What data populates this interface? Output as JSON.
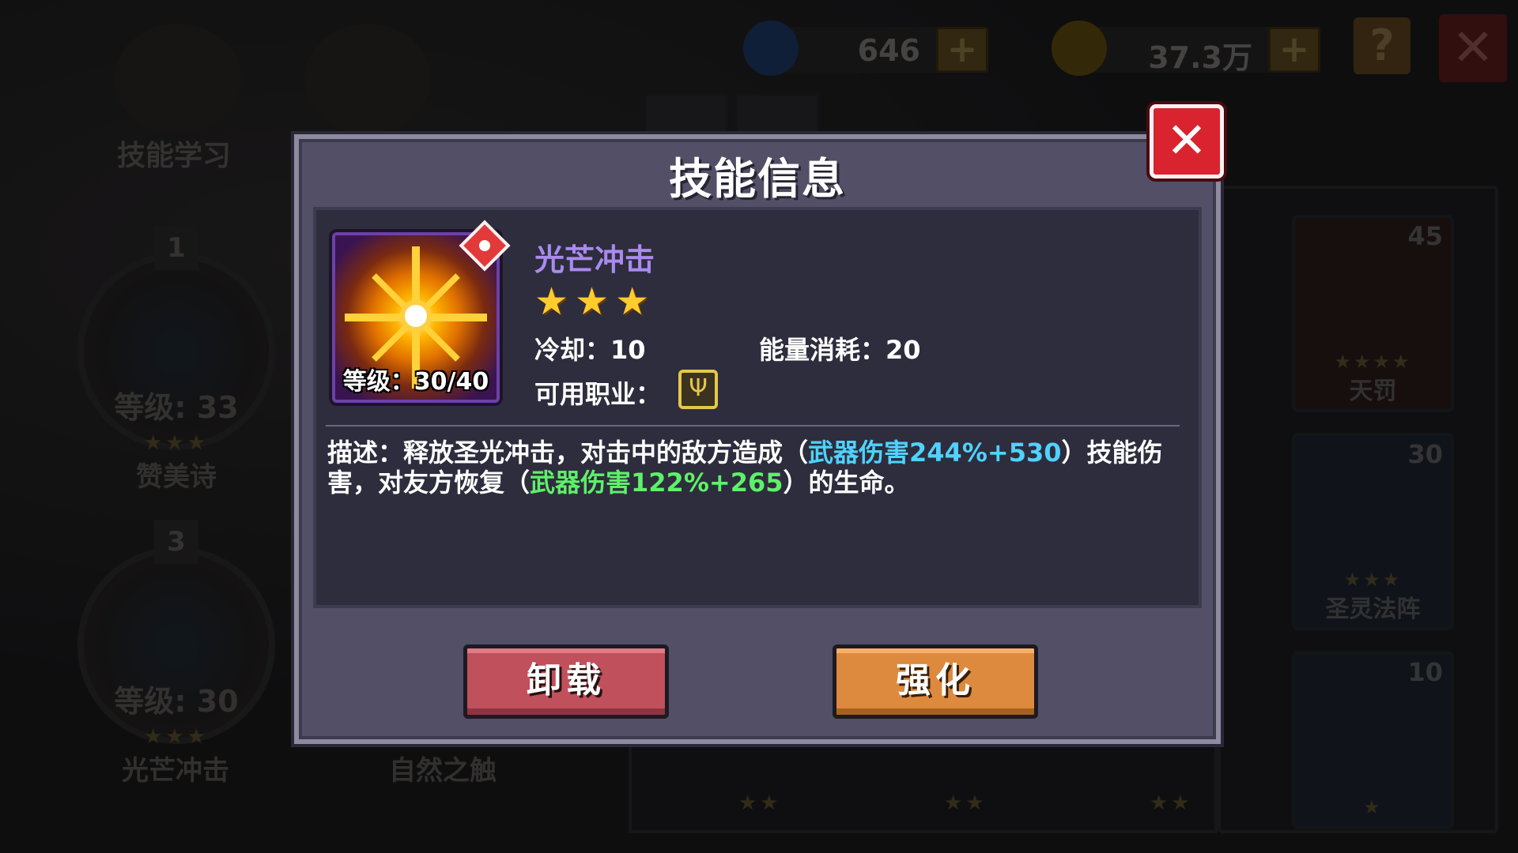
{
  "topbar": {
    "gems": "646",
    "gold": "37.3万",
    "plus": "+",
    "help": "?",
    "close": "✕"
  },
  "left_menu": {
    "skill_learn_label": "技能学习",
    "slot1": {
      "num": "1",
      "level": "等级: 33",
      "stars": "★★★",
      "name": "赞美诗"
    },
    "slot3": {
      "num": "3",
      "level": "等级: 30",
      "stars": "★★★",
      "name": "光芒冲击"
    },
    "nature_touch": "自然之触"
  },
  "right_panel": {
    "cards": [
      {
        "n": "45",
        "stars": "★★★★",
        "name": "天罚"
      },
      {
        "n": "30",
        "stars": "★★★",
        "name": "圣灵法阵"
      },
      {
        "n": "10",
        "stars": "★",
        "name": ""
      }
    ],
    "bottom_stars": [
      "★★",
      "★★",
      "★★"
    ]
  },
  "dialog": {
    "title": "技能信息",
    "skill": {
      "name": "光芒冲击",
      "stars": "★★★",
      "level_text": "等级：30/40",
      "cooldown": "冷却：10",
      "energy": "能量消耗：20",
      "class_label": "可用职业：",
      "class_icon": "priest-class-icon"
    },
    "description": {
      "prefix": "描述：释放圣光冲击，对击中的敌方造成（",
      "damage": "武器伤害244%+530",
      "middle": "）技能伤害，对友方恢复（",
      "heal": "武器伤害122%+265",
      "suffix": "）的生命。"
    },
    "buttons": {
      "unequip": "卸载",
      "enhance": "强化"
    },
    "close": "✕"
  },
  "colors": {
    "dialog_bg": "#524f67",
    "skill_name": "#a98af0",
    "damage_highlight": "#4fd2ff",
    "heal_highlight": "#5ff06a",
    "unequip_button": "#c0505c",
    "enhance_button": "#dd8a3e",
    "close_button": "#d9232f"
  }
}
